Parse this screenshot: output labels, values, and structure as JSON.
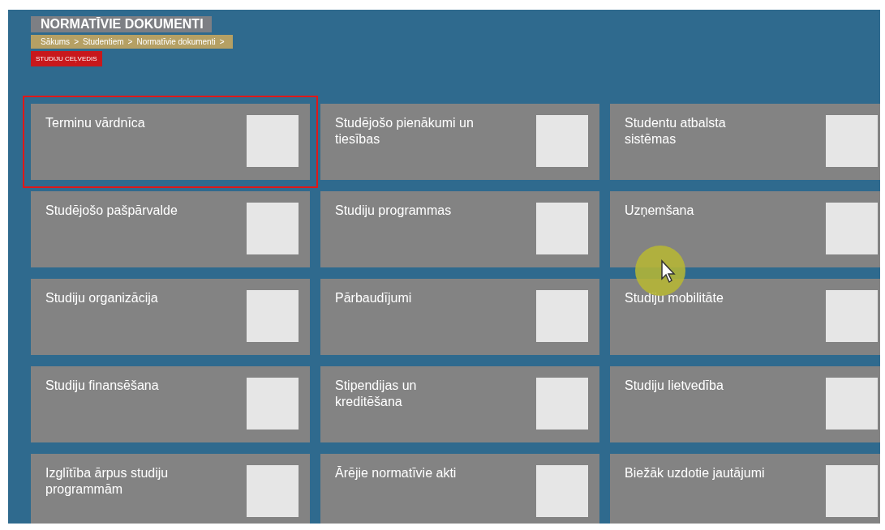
{
  "title": "NORMATĪVIE DOKUMENTI",
  "breadcrumb": [
    "Sākums",
    ">",
    "Studentiem",
    ">",
    "Normatīvie dokumenti",
    ">"
  ],
  "current_page": "STUDIJU CEĻVEDIS",
  "tiles": [
    {
      "label": "Terminu vārdnīca",
      "selected": true
    },
    {
      "label": "Studējošo pienākumi un tiesības",
      "selected": false
    },
    {
      "label": "Studentu atbalsta sistēmas",
      "selected": false
    },
    {
      "label": "Studējošo pašpārvalde",
      "selected": false
    },
    {
      "label": "Studiju programmas",
      "selected": false
    },
    {
      "label": "Uzņemšana",
      "selected": false
    },
    {
      "label": "Studiju organizācija",
      "selected": false
    },
    {
      "label": "Pārbaudījumi",
      "selected": false
    },
    {
      "label": "Studiju mobilitāte",
      "selected": false
    },
    {
      "label": "Studiju finansēšana",
      "selected": false
    },
    {
      "label": "Stipendijas un kreditēšana",
      "selected": false
    },
    {
      "label": "Studiju lietvedība",
      "selected": false
    },
    {
      "label": "Izglītība ārpus studiju programmām",
      "selected": false
    },
    {
      "label": "Ārējie normatīvie akti",
      "selected": false
    },
    {
      "label": "Biežāk uzdotie jautājumi",
      "selected": false
    }
  ]
}
